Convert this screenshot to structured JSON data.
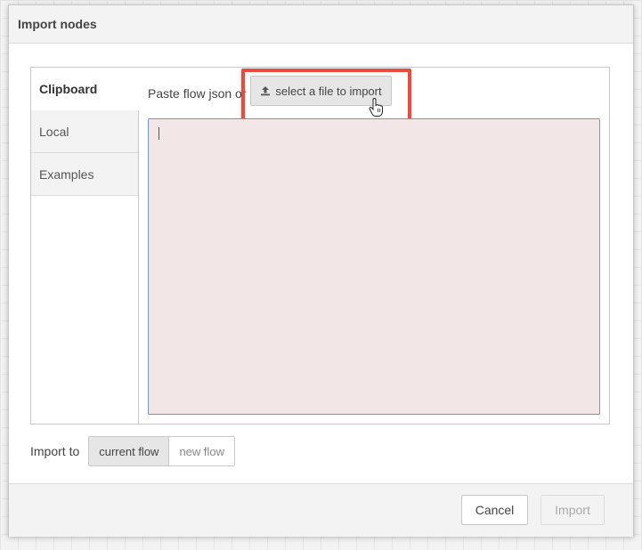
{
  "dialog": {
    "title": "Import nodes"
  },
  "tabs": [
    {
      "label": "Clipboard"
    },
    {
      "label": "Local"
    },
    {
      "label": "Examples"
    }
  ],
  "clipboard": {
    "paste_prefix": "Paste flow json or",
    "file_button_label": "select a file to import",
    "file_button_icon": "upload-icon",
    "textarea_value": ""
  },
  "import_to": {
    "label": "Import to",
    "options": [
      "current flow",
      "new flow"
    ],
    "selected": "current flow"
  },
  "footer": {
    "cancel_label": "Cancel",
    "import_label": "Import"
  },
  "colors": {
    "highlight": "#e74c3c",
    "textarea_bg": "#f3e6e6",
    "textarea_border": "#6f95d6"
  }
}
